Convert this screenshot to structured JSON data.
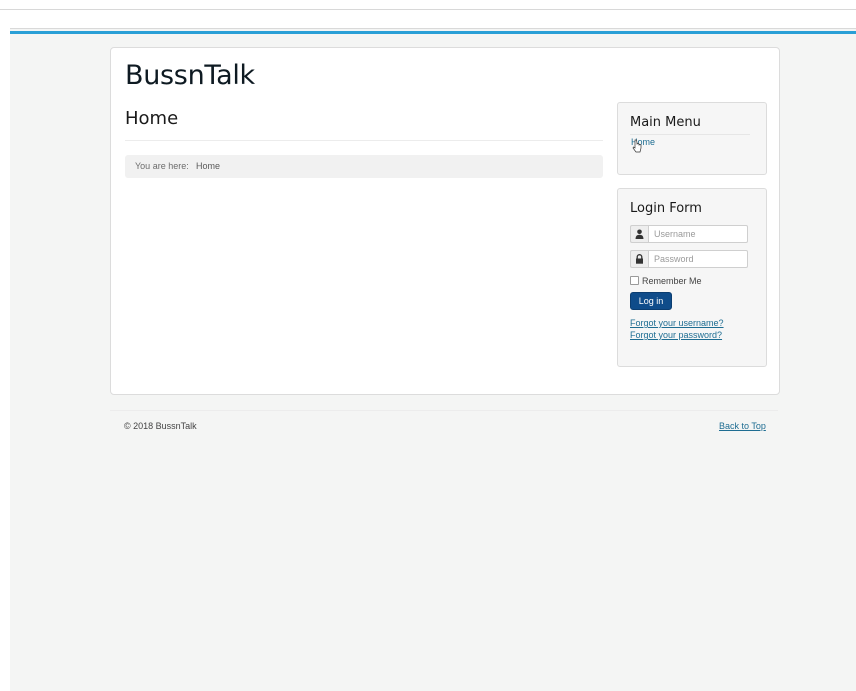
{
  "site": {
    "title": "BussnTalk"
  },
  "page": {
    "title": "Home"
  },
  "breadcrumb": {
    "label": "You are here:",
    "current": "Home"
  },
  "main_menu": {
    "title": "Main Menu",
    "items": [
      {
        "label": "Home"
      }
    ]
  },
  "login_form": {
    "title": "Login Form",
    "username_placeholder": "Username",
    "password_placeholder": "Password",
    "remember_label": "Remember Me",
    "submit_label": "Log in",
    "forgot_username": "Forgot your username?",
    "forgot_password": "Forgot your password?"
  },
  "footer": {
    "copyright": "© 2018 BussnTalk",
    "back_to_top": "Back to Top"
  },
  "colors": {
    "accent": "#2a9fd6",
    "link": "#1e6d92",
    "button": "#0f4c8a"
  }
}
